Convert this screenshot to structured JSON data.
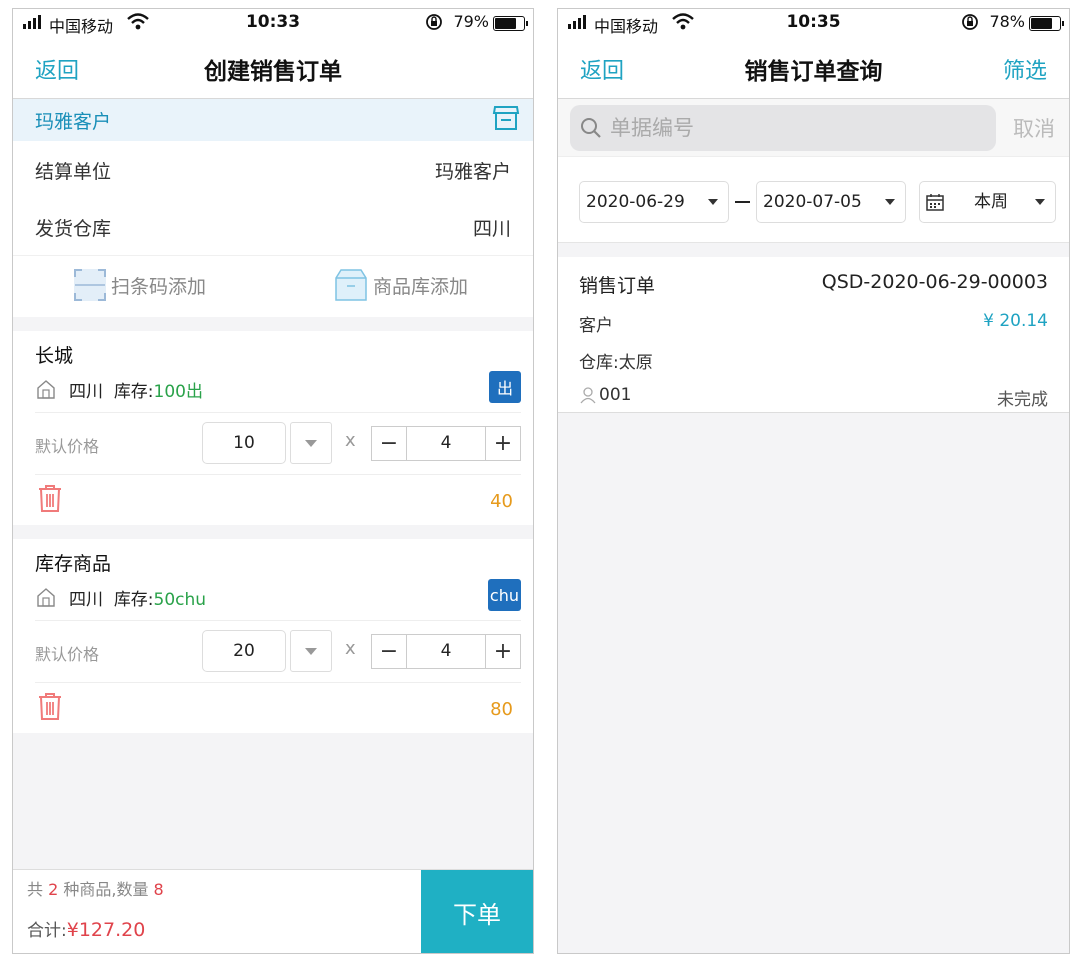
{
  "left": {
    "status": {
      "carrier": "中国移动",
      "time": "10:33",
      "battery": "79%",
      "battery_level": 0.79
    },
    "nav": {
      "back": "返回",
      "title": "创建销售订单"
    },
    "customer": "玛雅客户",
    "settlement": {
      "label": "结算单位",
      "value": "玛雅客户"
    },
    "warehouse": {
      "label": "发货仓库",
      "value": "四川"
    },
    "add": {
      "scan": "扫条码添加",
      "library": "商品库添加"
    },
    "items": [
      {
        "name": "长城",
        "warehouse": "四川",
        "stock_label": "库存:",
        "stock": "100出",
        "badge": "出",
        "price_label": "默认价格",
        "price": "10",
        "times": "x",
        "qty": "4",
        "total": "40"
      },
      {
        "name": "库存商品",
        "warehouse": "四川",
        "stock_label": "库存:",
        "stock": "50chu",
        "badge": "chu",
        "price_label": "默认价格",
        "price": "20",
        "times": "x",
        "qty": "4",
        "total": "80"
      }
    ],
    "footer": {
      "s1": "共 ",
      "kinds": "2",
      "s2": " 种商品,数量 ",
      "quantity": "8",
      "total_label": "合计:",
      "total": "¥127.20",
      "order_button": "下单"
    }
  },
  "right": {
    "status": {
      "carrier": "中国移动",
      "time": "10:35",
      "battery": "78%",
      "battery_level": 0.78
    },
    "nav": {
      "back": "返回",
      "title": "销售订单查询",
      "filter": "筛选"
    },
    "search": {
      "placeholder": "单据编号",
      "cancel": "取消"
    },
    "dates": {
      "start": "2020-06-29",
      "end": "2020-07-05",
      "range": "本周"
    },
    "order": {
      "type": "销售订单",
      "number": "QSD-2020-06-29-00003",
      "customer": "客户",
      "amount": "¥ 20.14",
      "warehouse": "仓库:太原",
      "user": "001",
      "state": "未完成"
    }
  },
  "colors": {
    "accent": "#1fa3c2",
    "order_button": "#1fb0c4",
    "price_red": "#e0434b",
    "total_orange": "#e69a1c",
    "stock_green": "#2aa24a",
    "badge_blue": "#1f6fbd"
  }
}
